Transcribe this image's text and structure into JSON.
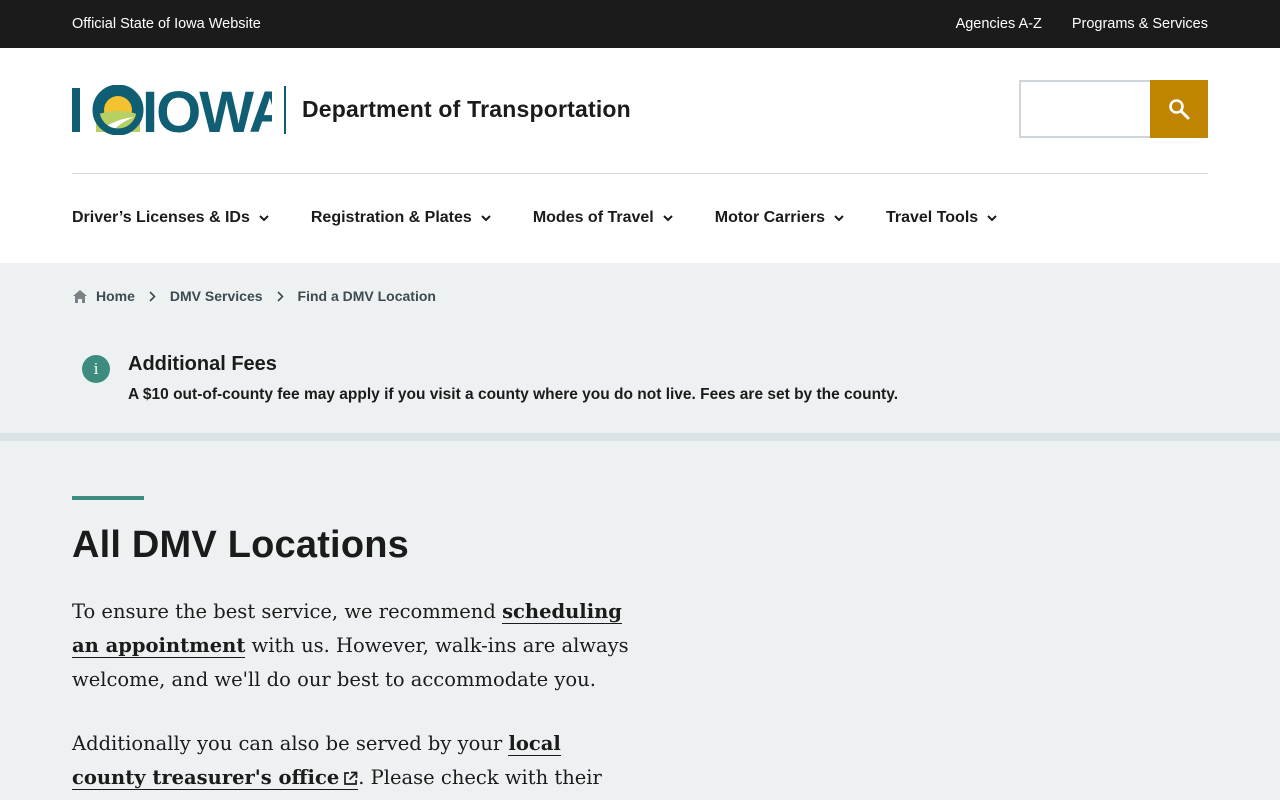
{
  "topbar": {
    "official": "Official State of Iowa Website",
    "links": [
      "Agencies A-Z",
      "Programs & Services"
    ]
  },
  "header": {
    "logo_text": "IOWA",
    "department": "Department of Transportation",
    "search": {
      "placeholder": "",
      "icon": "search-icon"
    }
  },
  "nav": {
    "items": [
      {
        "label": "Driver’s Licenses & IDs",
        "icon": "chevron-down-icon"
      },
      {
        "label": "Registration & Plates",
        "icon": "chevron-down-icon"
      },
      {
        "label": "Modes of Travel",
        "icon": "chevron-down-icon"
      },
      {
        "label": "Motor Carriers",
        "icon": "chevron-down-icon"
      },
      {
        "label": "Travel Tools",
        "icon": "chevron-down-icon"
      }
    ]
  },
  "breadcrumb": {
    "items": [
      "Home",
      "DMV Services",
      "Find a DMV Location"
    ]
  },
  "alert": {
    "title": "Additional Fees",
    "text": "A $10 out-of-county fee may apply if you visit a county where you do not live. Fees are set by the county."
  },
  "main": {
    "title": "All DMV Locations",
    "para1_before": "To ensure the best service, we recommend ",
    "para1_link": "scheduling an appointment",
    "para1_after": " with us. However, walk-ins are always welcome, and we'll do our best to accommodate you.",
    "para2_before": "Additionally you can also be served by your ",
    "para2_link": "local county treasurer's office",
    "para2_after": ". Please check with their office to see if"
  },
  "colors": {
    "topbar_bg": "#1b1b1b",
    "brand_teal": "#0f5e73",
    "search_button": "#bf8401",
    "accent_green": "#3d8c7e",
    "page_bg": "#edf1f2"
  }
}
